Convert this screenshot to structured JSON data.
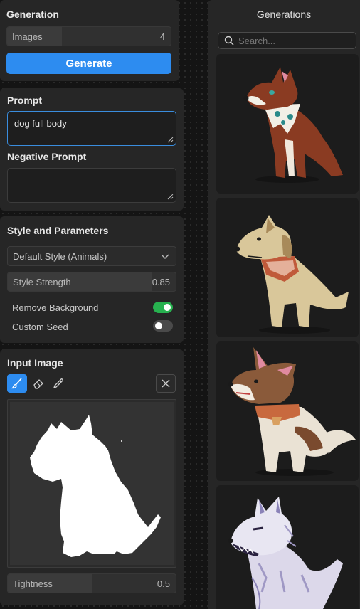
{
  "generation": {
    "title": "Generation",
    "images_label": "Images",
    "images_count": "4",
    "images_fraction": 0.2,
    "generate_button": "Generate"
  },
  "prompt": {
    "title": "Prompt",
    "value": "dog full body",
    "negative_title": "Negative Prompt",
    "negative_value": ""
  },
  "style": {
    "title": "Style and Parameters",
    "selected_style": "Default Style (Animals)",
    "strength_label": "Style Strength",
    "strength_value": "0.85",
    "strength_fraction": 0.85,
    "remove_background_label": "Remove Background",
    "remove_background_on": true,
    "custom_seed_label": "Custom Seed",
    "custom_seed_on": false
  },
  "input_image": {
    "title": "Input Image",
    "tools": [
      "brush-icon",
      "eraser-icon",
      "eyedropper-icon"
    ],
    "tightness_label": "Tightness",
    "tightness_value": "0.5",
    "tightness_fraction": 0.5
  },
  "generations": {
    "title": "Generations",
    "search_placeholder": "Search...",
    "items": [
      "brown-dog-bandana-image",
      "tan-dog-harness-image",
      "husky-collar-image",
      "white-wolf-image"
    ]
  },
  "colors": {
    "accent": "#2d8cf0",
    "toggle_on": "#27b14f",
    "focus_border": "#3a8dde"
  }
}
